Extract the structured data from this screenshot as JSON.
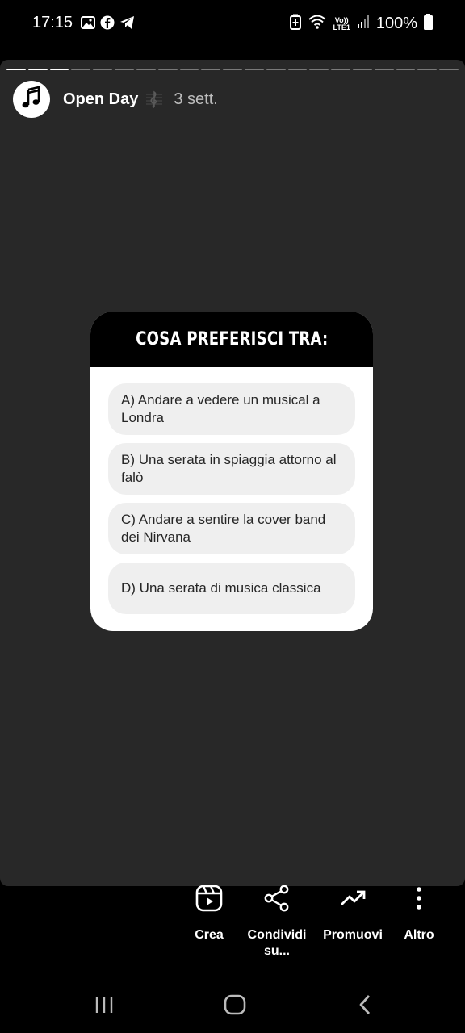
{
  "status_bar": {
    "time": "17:15",
    "left_icons": [
      "gallery-icon",
      "facebook-icon",
      "telegram-icon"
    ],
    "right_icons": [
      "battery-saver-icon",
      "wifi-icon",
      "volte-icon",
      "signal-icon"
    ],
    "volte_label": "Vo))\nLTE1",
    "battery": "100%"
  },
  "story": {
    "progress_segments": 21,
    "progress_done": 3,
    "account_name": "Open Day",
    "time_ago": "3 sett."
  },
  "quiz": {
    "title": "COSA PREFERISCI TRA:",
    "options": [
      {
        "label": "A) Andare a vedere un musical a Londra"
      },
      {
        "label": "B) Una serata in spiaggia attorno al falò"
      },
      {
        "label": "C) Andare a sentire la cover band dei Nirvana"
      },
      {
        "label": "D) Una serata di musica classica"
      }
    ]
  },
  "actions": {
    "create": "Crea",
    "share": "Condividi su...",
    "promote": "Promuovi",
    "more": "Altro"
  },
  "colors": {
    "background": "#000000",
    "story_bg": "#282828",
    "option_bg": "#efefef"
  }
}
